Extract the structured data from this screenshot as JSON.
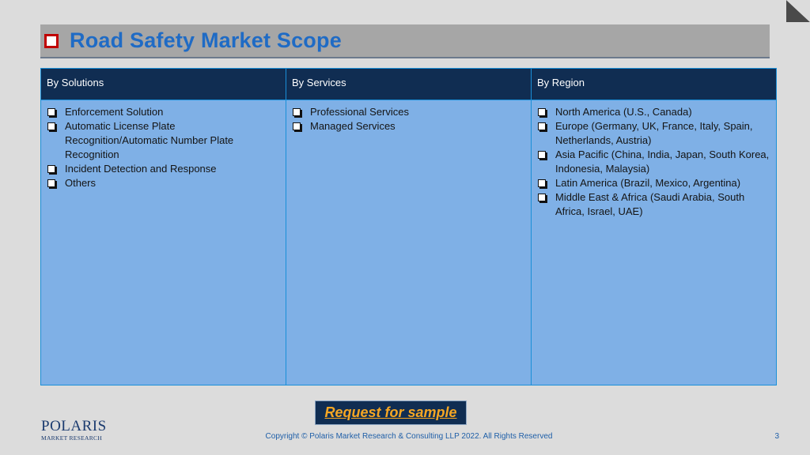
{
  "title": "Road Safety Market Scope",
  "columns": [
    {
      "header": "By Solutions",
      "items": [
        "Enforcement Solution",
        "Automatic License Plate Recognition/Automatic Number Plate Recognition",
        "Incident Detection and Response",
        "Others"
      ]
    },
    {
      "header": "By Services",
      "items": [
        "Professional Services",
        "Managed Services"
      ]
    },
    {
      "header": "By Region",
      "items": [
        "North America (U.S., Canada)",
        "Europe (Germany, UK, France, Italy, Spain, Netherlands, Austria)",
        "Asia Pacific (China, India, Japan, South Korea, Indonesia, Malaysia)",
        "Latin America (Brazil, Mexico, Argentina)",
        "Middle East & Africa (Saudi Arabia, South Africa, Israel, UAE)"
      ]
    }
  ],
  "cta_label": "Request for sample",
  "logo": {
    "main": "POLARIS",
    "sub": "MARKET RESEARCH"
  },
  "footer": "Copyright © Polaris Market Research & Consulting LLP 2022. All Rights Reserved",
  "page_number": "3",
  "icons": {
    "title_bullet": "checkbox-icon",
    "list_bullet": "checkbox-icon",
    "corner": "page-fold-icon"
  },
  "colors": {
    "title": "#1f6bc5",
    "header_bg": "#102d52",
    "cell_bg": "#7fb0e6",
    "cta_text": "#f5a623"
  }
}
